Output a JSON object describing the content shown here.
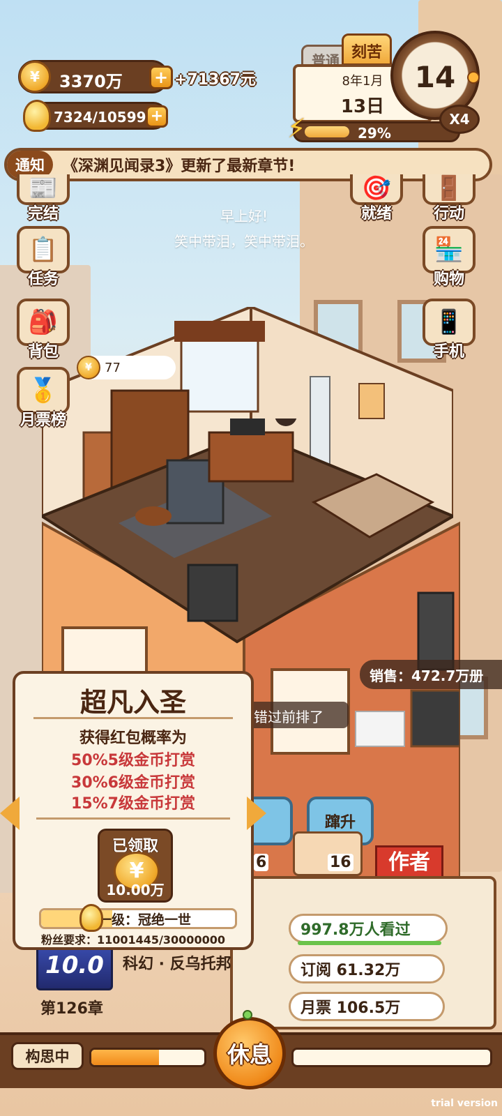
{
  "hud": {
    "money": "3370万",
    "money_gain": "+71367元",
    "energy": "7324/10599",
    "plus_label": "+",
    "coin_glyph": "¥",
    "mode_tabs": [
      "普通",
      "刻苦"
    ],
    "date_ym": "8年1月",
    "date_day": "13日",
    "day_number": "14",
    "speed": "X4",
    "progress_percent": "29%",
    "progress_value": 0.29
  },
  "notice": {
    "tag": "通知",
    "text": "《深渊见闻录3》更新了最新章节!"
  },
  "left_menu": [
    {
      "label": "完结",
      "icon": "newspaper-icon"
    },
    {
      "label": "任务",
      "icon": "checklist-icon"
    },
    {
      "label": "背包",
      "icon": "backpack-icon"
    },
    {
      "label": "月票榜",
      "icon": "ranking-coin-icon"
    }
  ],
  "right_menu": [
    {
      "label": "就绪",
      "icon": "dartboard-icon"
    },
    {
      "label": "行动",
      "icon": "door-icon"
    },
    {
      "label": "购物",
      "icon": "shop-icon"
    },
    {
      "label": "手机",
      "icon": "phone-icon"
    }
  ],
  "greeting": {
    "line1": "早上好!",
    "line2": "笑中带泪，笑中带泪。"
  },
  "room": {
    "coin_count": "77",
    "sales": "销售：472.7万册",
    "bubble": "错过前排了"
  },
  "skills": {
    "upgrade_label": "蹿升",
    "count_a": "6",
    "count_b": "16",
    "author_badge": "作者"
  },
  "book": {
    "readers": "997.8万人看过",
    "subscriptions": "订阅 61.32万",
    "monthly_votes": "月票 106.5万",
    "genre": "科幻 · 反乌托邦",
    "cover_text": "10.0",
    "chapter": "第126章"
  },
  "bottom": {
    "status": "构思中",
    "rest": "休息",
    "write_progress": 0.6,
    "trial": "trial version"
  },
  "popup": {
    "title": "超凡入圣",
    "intro": "获得红包概率为",
    "rewards": [
      "50%5级金币打赏",
      "30%6级金币打赏",
      "15%7级金币打赏"
    ],
    "claim_status": "已领取",
    "claim_amount": "10.00万",
    "next_level": "下一级：冠绝一世",
    "fans_requirement": "粉丝要求：11001445/30000000",
    "fans_progress": 0.367
  }
}
